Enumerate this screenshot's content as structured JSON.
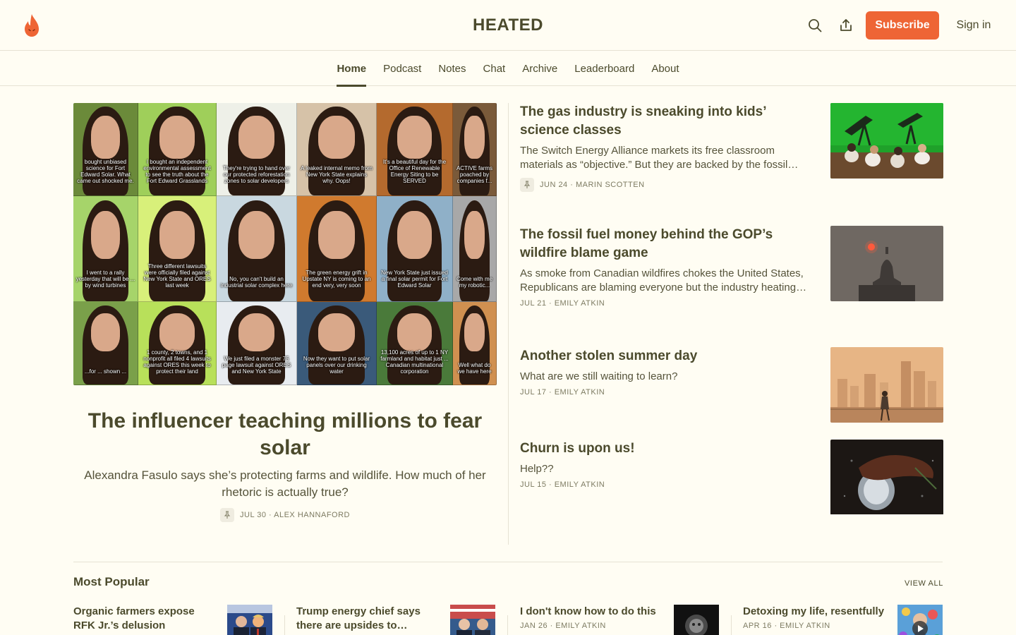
{
  "header": {
    "title": "HEATED",
    "subscribe_label": "Subscribe",
    "signin_label": "Sign in",
    "accent": "#ee6535"
  },
  "nav": {
    "items": [
      {
        "label": "Home",
        "active": true
      },
      {
        "label": "Podcast"
      },
      {
        "label": "Notes"
      },
      {
        "label": "Chat"
      },
      {
        "label": "Archive"
      },
      {
        "label": "Leaderboard"
      },
      {
        "label": "About"
      }
    ]
  },
  "hero": {
    "title": "The influencer teaching millions to fear solar",
    "subtitle": "Alexandra Fasulo says she’s protecting farms and wildlife. How much of her rhetoric is actually true?",
    "meta": "JUL 30 · ALEX HANNAFORD",
    "captions": [
      "bought unbiased science for Fort Edward Solar. What came out shocked me.",
      "I bought an independent environmental assessment to see the truth about the Fort Edward Grasslands",
      "They're trying to hand over our protected reforestation zones to solar developers",
      "A leaked internal memo from New York State explains why. Oops!",
      "It's a beautiful day for the Office of Renewable Energy Siting to be SERVED",
      "ACTIVE farms poached by companies f...",
      "I went to a rally yesterday that will be ... by wind turbines",
      "Three different lawsuits were officially filed against New York State and ORES last week",
      "No, you can't build an industrial solar complex here",
      "The green energy grift in Upstate NY is coming to an end very, very soon",
      "New York State just issued a final solar permit for Fort Edward Solar",
      "Come with me my robotic...",
      "...for ... shown ...",
      "1 county, 2 towns, and 1 nonprofit all filed 4 lawsuits against ORES this week to protect their land",
      "We just filed a monster 75 page lawsuit against ORES and New York State",
      "Now they want to put solar panels over our drinking water",
      "13,100 acres of up to 1 NY farmland and habitat just ... Canadian multinational corporation",
      "Well what do we have here"
    ]
  },
  "posts": [
    {
      "title": "The gas industry is sneaking into kids’ science classes",
      "subtitle": "The Switch Energy Alliance markets its free classroom materials as “objective.” But they are backed by the fossil…",
      "meta": "JUN 24 · MARIN SCOTTEN",
      "pinned": true
    },
    {
      "title": "The fossil fuel money behind the GOP’s wildfire blame game",
      "subtitle": "As smoke from Canadian wildfires chokes the United States, Republicans are blaming everyone but the industry heating…",
      "meta": "JUL 21 · EMILY ATKIN"
    },
    {
      "title": "Another stolen summer day",
      "subtitle": "What are we still waiting to learn?",
      "meta": "JUL 17 · EMILY ATKIN"
    },
    {
      "title": "Churn is upon us!",
      "subtitle": "Help??",
      "meta": "JUL 15 · EMILY ATKIN"
    }
  ],
  "popular": {
    "heading": "Most Popular",
    "view_all": "VIEW ALL",
    "items": [
      {
        "title": "Organic farmers expose RFK Jr.’s delusion",
        "meta": ""
      },
      {
        "title": "Trump energy chief says there are upsides to…",
        "meta": ""
      },
      {
        "title": "I don't know how to do this",
        "meta": "JAN 26 · EMILY ATKIN"
      },
      {
        "title": "Detoxing my life, resentfully",
        "meta": "APR 16 · EMILY ATKIN"
      }
    ]
  }
}
